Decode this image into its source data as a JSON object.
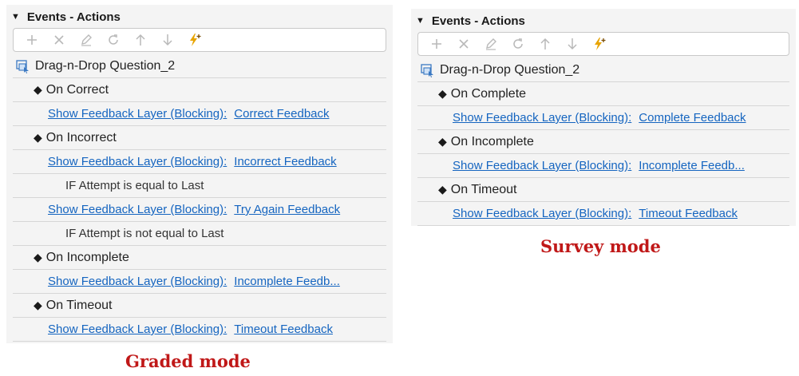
{
  "panels": {
    "graded": {
      "header": "Events - Actions",
      "object_name": "Drag-n-Drop Question_2",
      "rows": [
        {
          "kind": "event",
          "label": "On Correct"
        },
        {
          "kind": "action",
          "action": "Show Feedback Layer (Blocking):",
          "target": "Correct Feedback"
        },
        {
          "kind": "event",
          "label": "On Incorrect"
        },
        {
          "kind": "action",
          "action": "Show Feedback Layer (Blocking):",
          "target": "Incorrect Feedback"
        },
        {
          "kind": "cond",
          "label": "IF Attempt is equal to Last"
        },
        {
          "kind": "action",
          "action": "Show Feedback Layer (Blocking):",
          "target": "Try Again Feedback"
        },
        {
          "kind": "cond",
          "label": "IF Attempt is not equal to Last"
        },
        {
          "kind": "event",
          "label": "On Incomplete"
        },
        {
          "kind": "action",
          "action": "Show Feedback Layer (Blocking):",
          "target": "Incomplete Feedb..."
        },
        {
          "kind": "event",
          "label": "On Timeout"
        },
        {
          "kind": "action",
          "action": "Show Feedback Layer (Blocking):",
          "target": "Timeout Feedback"
        }
      ],
      "caption": "Graded mode"
    },
    "survey": {
      "header": "Events - Actions",
      "object_name": "Drag-n-Drop Question_2",
      "rows": [
        {
          "kind": "event",
          "label": "On Complete"
        },
        {
          "kind": "action",
          "action": "Show Feedback Layer (Blocking):",
          "target": "Complete Feedback"
        },
        {
          "kind": "event",
          "label": "On Incomplete"
        },
        {
          "kind": "action",
          "action": "Show Feedback Layer (Blocking):",
          "target": "Incomplete Feedb..."
        },
        {
          "kind": "event",
          "label": "On Timeout"
        },
        {
          "kind": "action",
          "action": "Show Feedback Layer (Blocking):",
          "target": "Timeout Feedback"
        }
      ],
      "caption": "Survey mode"
    }
  },
  "toolbar_icons": [
    "add-icon",
    "delete-icon",
    "edit-icon",
    "refresh-icon",
    "move-up-icon",
    "move-down-icon",
    "add-event-icon"
  ],
  "colors": {
    "link": "#1565c0",
    "caption": "#c01818",
    "panel_bg": "#f4f4f4",
    "add_event_icon": "#e8a400"
  }
}
